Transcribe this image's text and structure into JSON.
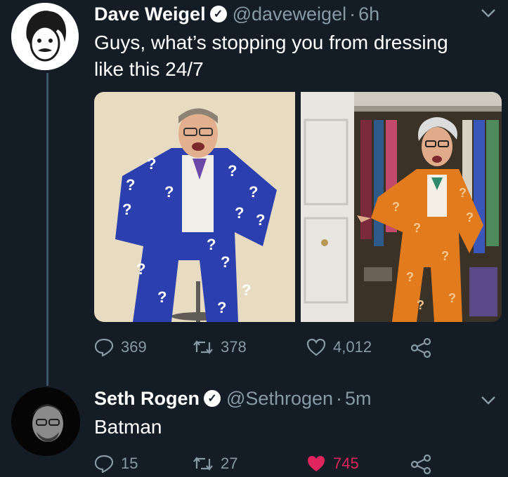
{
  "tweets": [
    {
      "name": "Dave Weigel",
      "handle": "@daveweigel",
      "time": "6h",
      "text_line1": "Guys, what’s stopping you from dressing",
      "text_line2": "like this 24/7",
      "stats": {
        "replies": "369",
        "retweets": "378",
        "likes": "4,012"
      }
    },
    {
      "name": "Seth Rogen",
      "handle": "@Sethrogen",
      "time": "5m",
      "text": "Batman",
      "stats": {
        "replies": "15",
        "retweets": "27",
        "likes": "745"
      }
    }
  ],
  "icons": {
    "verified": "verified-badge-icon",
    "reply": "reply-icon",
    "retweet": "retweet-icon",
    "like": "heart-icon",
    "share": "share-icon",
    "menu": "chevron-down-icon"
  },
  "colors": {
    "background": "#141d26",
    "secondary_text": "#8899a6",
    "like_active": "#e0245e",
    "thread_line": "#3d5466"
  }
}
